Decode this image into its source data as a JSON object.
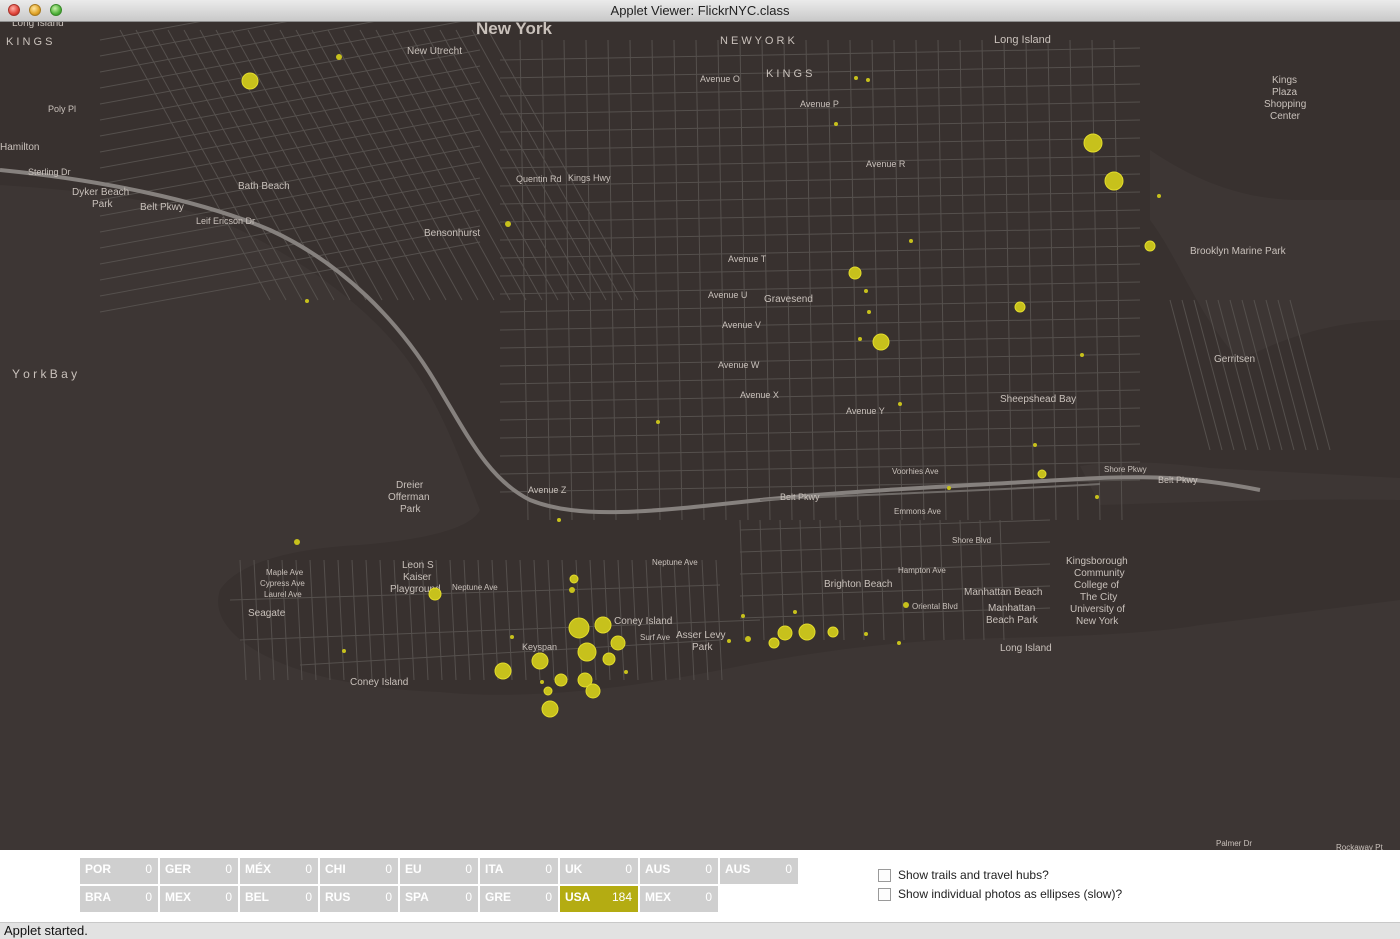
{
  "window": {
    "title": "Applet Viewer: FlickrNYC.class"
  },
  "map": {
    "colors": {
      "land": "#38312f",
      "water": "#3f3937",
      "street": "#55504d",
      "highway": "#807b79",
      "dot": "#c7c11c",
      "dot_stroke": "#e3dc2c"
    },
    "labels": {
      "new_york": "New York",
      "long_island_nw": "Long Island",
      "kings_w": "K I N G S",
      "new_york_spaced": "N E W   Y O R K",
      "kings_mid": "K I N G S",
      "long_island_ne": "Long Island",
      "new_utrecht": "New Utrecht",
      "hamilton": "Hamilton",
      "poly_pl": "Poly Pl",
      "sterling_dr": "Sterling Dr",
      "dyker_beach_park": "Dyker Beach",
      "dyker_beach_park2": "Park",
      "bath_beach": "Bath Beach",
      "bensonhurst": "Bensonhurst",
      "belt_pkwy_w": "Belt Pkwy",
      "leif_ericson_dr": "Leif Ericson Dr",
      "york_bay": "Y o r k   B a y",
      "quentin_rd": "Quentin Rd",
      "kings_hwy": "Kings Hwy",
      "avenue_o": "Avenue O",
      "avenue_p": "Avenue P",
      "avenue_t": "Avenue T",
      "avenue_u": "Avenue U",
      "avenue_v": "Avenue V",
      "avenue_w": "Avenue W",
      "avenue_x": "Avenue X",
      "avenue_y": "Avenue Y",
      "avenue_z": "Avenue Z",
      "gravesend": "Gravesend",
      "avenue_r": "Avenue R",
      "kings_plaza": "Kings",
      "kings_plaza2": "Plaza",
      "kings_plaza3": "Shopping",
      "kings_plaza4": "Center",
      "brooklyn_marine_park": "Brooklyn Marine Park",
      "gerritsen": "Gerritsen",
      "sheepshead_bay": "Sheepshead Bay",
      "shore_pkwy": "Shore Pkwy",
      "belt_pkwy_e": "Belt Pkwy",
      "belt_pkwy_mid": "Belt Pkwy",
      "voorhies_ave": "Voorhies Ave",
      "emmons_ave": "Emmons Ave",
      "dreier": "Dreier",
      "dreier2": "Offerman",
      "dreier3": "Park",
      "leon_s_kaiser": "Leon S",
      "leon_s_kaiser2": "Kaiser",
      "leon_s_kaiser3": "Playground",
      "neptune_ave": "Neptune Ave",
      "neptune_ave_e": "Neptune Ave",
      "seagate": "Seagate",
      "surf_ave": "Surf Ave",
      "coney_island": "Coney Island",
      "coney_island_bottom": "Coney Island",
      "keyspan": "Keyspan",
      "asser_levy": "Asser Levy",
      "asser_levy2": "Park",
      "brighton_beach": "Brighton Beach",
      "manhattan_beach": "Manhattan Beach",
      "manhattan_beach_park": "Manhattan",
      "manhattan_beach_park2": "Beach Park",
      "kbcc": "Kingsborough",
      "kbcc2": "Community",
      "kbcc3": "College of",
      "kbcc4": "The City",
      "kbcc5": "University of",
      "kbcc6": "New York",
      "long_island_se": "Long Island",
      "oriental_blvd": "Oriental Blvd",
      "hampton_ave": "Hampton Ave",
      "shore_blvd": "Shore Blvd",
      "palmer_dr": "Palmer Dr",
      "rockaway_pt": "Rockaway Pt",
      "maple_ave": "Maple Ave",
      "cypress_ave": "Cypress Ave",
      "laurel_ave": "Laurel Ave"
    },
    "dots": [
      {
        "lon": 250,
        "lat": 81,
        "size": 8
      },
      {
        "lon": 339,
        "lat": 57,
        "size": 3
      },
      {
        "lon": 508,
        "lat": 224,
        "size": 3
      },
      {
        "lon": 307,
        "lat": 301,
        "size": 2
      },
      {
        "lon": 1093,
        "lat": 143,
        "size": 9
      },
      {
        "lon": 1114,
        "lat": 181,
        "size": 9
      },
      {
        "lon": 1150,
        "lat": 246,
        "size": 5
      },
      {
        "lon": 1159,
        "lat": 196,
        "size": 2
      },
      {
        "lon": 855,
        "lat": 273,
        "size": 6
      },
      {
        "lon": 881,
        "lat": 342,
        "size": 8
      },
      {
        "lon": 1020,
        "lat": 307,
        "size": 5
      },
      {
        "lon": 911,
        "lat": 241,
        "size": 2
      },
      {
        "lon": 836,
        "lat": 124,
        "size": 2
      },
      {
        "lon": 856,
        "lat": 78,
        "size": 2
      },
      {
        "lon": 868,
        "lat": 80,
        "size": 2
      },
      {
        "lon": 860,
        "lat": 339,
        "size": 2
      },
      {
        "lon": 869,
        "lat": 312,
        "size": 2
      },
      {
        "lon": 900,
        "lat": 404,
        "size": 2
      },
      {
        "lon": 866,
        "lat": 291,
        "size": 2
      },
      {
        "lon": 1082,
        "lat": 355,
        "size": 2
      },
      {
        "lon": 1035,
        "lat": 445,
        "size": 2
      },
      {
        "lon": 1042,
        "lat": 474,
        "size": 4
      },
      {
        "lon": 1097,
        "lat": 497,
        "size": 2
      },
      {
        "lon": 949,
        "lat": 488,
        "size": 2
      },
      {
        "lon": 658,
        "lat": 422,
        "size": 2
      },
      {
        "lon": 559,
        "lat": 520,
        "size": 2
      },
      {
        "lon": 297,
        "lat": 542,
        "size": 3
      },
      {
        "lon": 435,
        "lat": 594,
        "size": 6
      },
      {
        "lon": 574,
        "lat": 579,
        "size": 4
      },
      {
        "lon": 572,
        "lat": 590,
        "size": 3
      },
      {
        "lon": 579,
        "lat": 628,
        "size": 10
      },
      {
        "lon": 603,
        "lat": 625,
        "size": 8
      },
      {
        "lon": 618,
        "lat": 643,
        "size": 7
      },
      {
        "lon": 587,
        "lat": 652,
        "size": 9
      },
      {
        "lon": 609,
        "lat": 659,
        "size": 6
      },
      {
        "lon": 540,
        "lat": 661,
        "size": 8
      },
      {
        "lon": 503,
        "lat": 671,
        "size": 8
      },
      {
        "lon": 561,
        "lat": 680,
        "size": 6
      },
      {
        "lon": 585,
        "lat": 680,
        "size": 7
      },
      {
        "lon": 593,
        "lat": 691,
        "size": 7
      },
      {
        "lon": 548,
        "lat": 691,
        "size": 4
      },
      {
        "lon": 542,
        "lat": 682,
        "size": 2
      },
      {
        "lon": 550,
        "lat": 709,
        "size": 8
      },
      {
        "lon": 626,
        "lat": 672,
        "size": 2
      },
      {
        "lon": 512,
        "lat": 637,
        "size": 2
      },
      {
        "lon": 344,
        "lat": 651,
        "size": 2
      },
      {
        "lon": 729,
        "lat": 641,
        "size": 2
      },
      {
        "lon": 748,
        "lat": 639,
        "size": 3
      },
      {
        "lon": 774,
        "lat": 643,
        "size": 5
      },
      {
        "lon": 785,
        "lat": 633,
        "size": 7
      },
      {
        "lon": 807,
        "lat": 632,
        "size": 8
      },
      {
        "lon": 833,
        "lat": 632,
        "size": 5
      },
      {
        "lon": 906,
        "lat": 605,
        "size": 3
      },
      {
        "lon": 866,
        "lat": 634,
        "size": 2
      },
      {
        "lon": 899,
        "lat": 643,
        "size": 2
      },
      {
        "lon": 795,
        "lat": 612,
        "size": 2
      },
      {
        "lon": 743,
        "lat": 616,
        "size": 2
      }
    ]
  },
  "countries": [
    {
      "code": "POR",
      "count": "0"
    },
    {
      "code": "GER",
      "count": "0"
    },
    {
      "code": "MÉX",
      "count": "0"
    },
    {
      "code": "CHI",
      "count": "0"
    },
    {
      "code": "EU",
      "count": "0"
    },
    {
      "code": "ITA",
      "count": "0"
    },
    {
      "code": "UK",
      "count": "0"
    },
    {
      "code": "AUS",
      "count": "0"
    },
    {
      "code": "AUS",
      "count": "0"
    },
    {
      "code": "BRA",
      "count": "0"
    },
    {
      "code": "MEX",
      "count": "0"
    },
    {
      "code": "BEL",
      "count": "0"
    },
    {
      "code": "RUS",
      "count": "0"
    },
    {
      "code": "SPA",
      "count": "0"
    },
    {
      "code": "GRE",
      "count": "0"
    },
    {
      "code": "USA",
      "count": "184",
      "active": true
    },
    {
      "code": "MEX",
      "count": "0"
    }
  ],
  "options": {
    "trails": "Show trails and travel hubs?",
    "ellipses": "Show individual photos as ellipses (slow)?"
  },
  "status": {
    "text": "Applet started."
  }
}
